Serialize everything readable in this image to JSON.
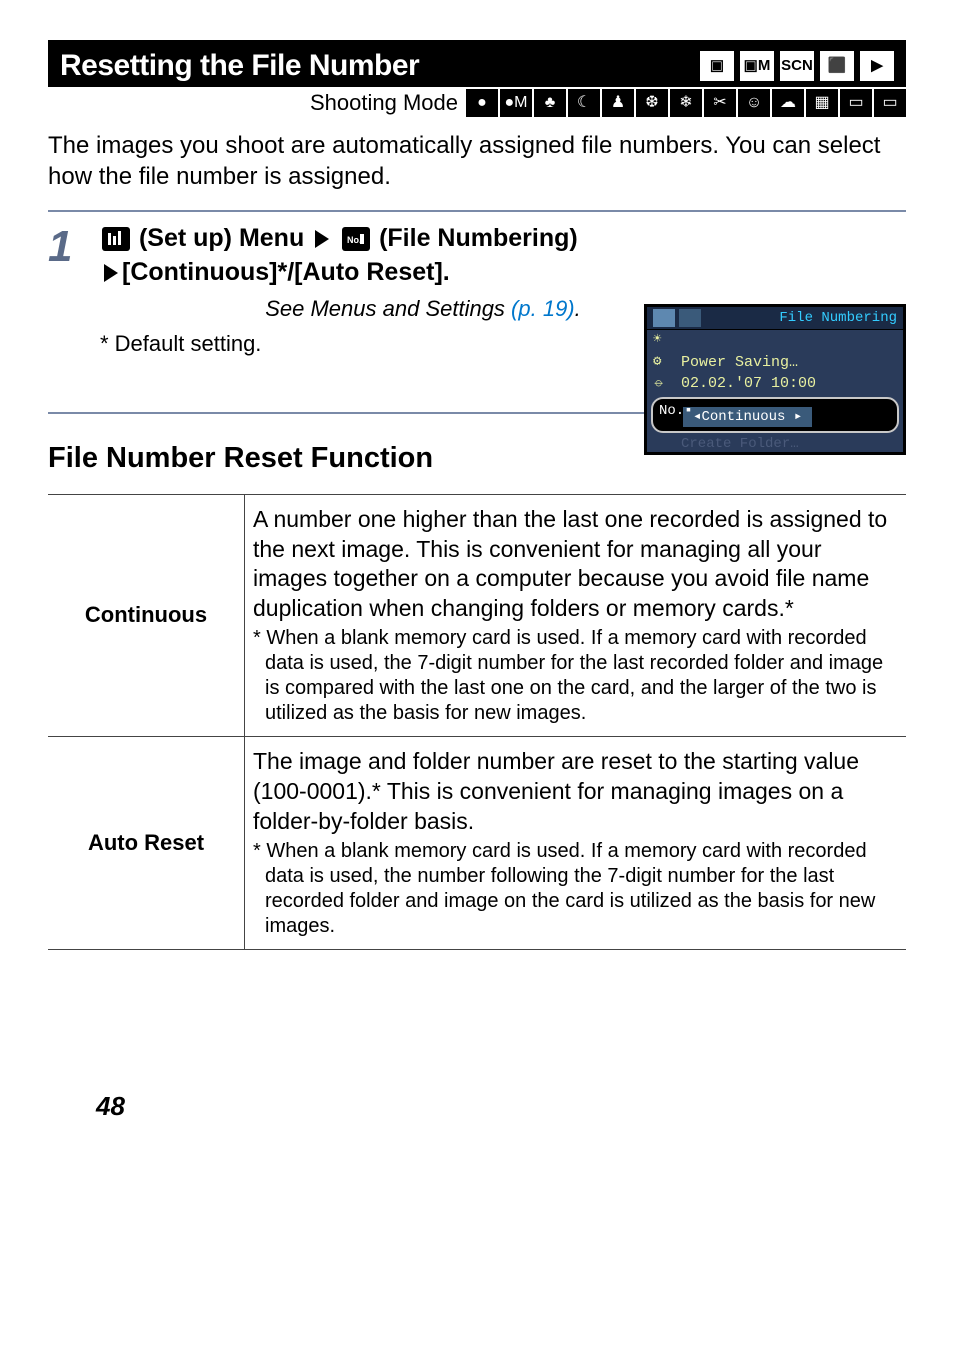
{
  "titleBar": {
    "text": "Resetting the File Number",
    "icons": [
      "▣",
      "▣M",
      "SCN",
      "⬛",
      "▶"
    ]
  },
  "shootingMode": {
    "label": "Shooting Mode",
    "icons": [
      "●",
      "●M",
      "♣",
      "☾",
      "♟",
      "❆",
      "❄",
      "✂",
      "☺",
      "☁",
      "▦",
      "▭",
      "▭"
    ]
  },
  "intro": "The images you shoot are automatically assigned file numbers. You can select how the file number is assigned.",
  "step": {
    "number": "1",
    "h_parts": {
      "pre1": "",
      "label1": "(Set up) Menu",
      "label2": "(File Numbering)",
      "line2": "[Continuous]*/[Auto Reset]."
    },
    "sub_note_pre": "See Menus and Settings ",
    "sub_note_link": "(p. 19)",
    "sub_note_post": ".",
    "default": "* Default setting."
  },
  "screenshot": {
    "title": "File Numbering",
    "rows": [
      {
        "icon": "☀",
        "text": " "
      },
      {
        "icon": "⚙",
        "text": "Power Saving…"
      },
      {
        "icon": "⦵",
        "text": "02.02.'07 10:00"
      }
    ],
    "highlight": {
      "icon": "No.▪",
      "value": "Continuous"
    },
    "dim": "Create Folder…"
  },
  "section_heading": "File Number Reset Function",
  "table": [
    {
      "label": "Continuous",
      "main": "A number one higher than the last one recorded is assigned to the next image. This is convenient for managing all your images together on a computer because you avoid file name duplication when changing folders or memory cards.*",
      "foot": "* When a blank memory card is used. If a memory card with recorded data is used, the 7-digit number for the last recorded folder and image is compared with the last one on the card, and the larger of the two is utilized as the basis for new images."
    },
    {
      "label": "Auto Reset",
      "main": "The image and folder number are reset to the starting value (100-0001).* This is convenient for managing images on a folder-by-folder basis.",
      "foot": "* When a blank memory card is used. If a memory card with recorded data is used, the number following the 7-digit number for the last recorded folder and image on the card is utilized as the basis for new images."
    }
  ],
  "page_number": "48"
}
